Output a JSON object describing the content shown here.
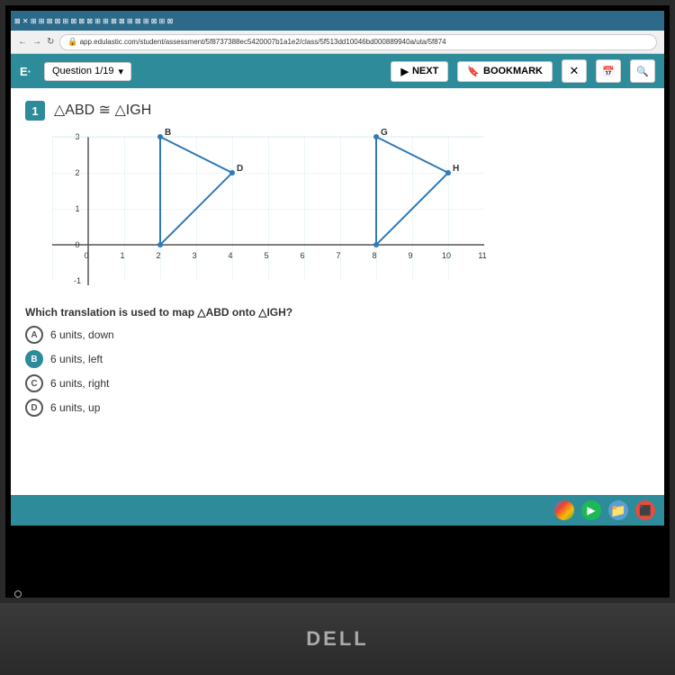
{
  "browser": {
    "tab_content": "⊠ ✕ ⊞ ⊞ ⊠ ⊠ ⊞ ⊠ ⊠ ⊠ ⊞ ⊞ ⊠ ⊠ ⊞ ⊠ ⊞ ⊠ ⊞ ⊠",
    "address": "app.edulastic.com/student/assessment/5f8737388ec5420007b1a1e2/class/5f513dd10046bd000889940a/uta/5f874",
    "nav_back": "←",
    "nav_forward": "→",
    "nav_reload": "↻"
  },
  "toolbar": {
    "question_label": "Question 1/19",
    "next_label": "NEXT",
    "bookmark_label": "BOOKMARK",
    "close_icon": "✕",
    "calendar_icon": "📅",
    "search_icon": "🔍"
  },
  "question": {
    "number": "1",
    "title": "△ABD ≅ △IGH",
    "text": "Which translation is used to map △ABD onto △IGH?",
    "choices": [
      {
        "id": "A",
        "text": "6 units, down",
        "selected": false
      },
      {
        "id": "B",
        "text": "6 units, left",
        "selected": true
      },
      {
        "id": "C",
        "text": "6 units, right",
        "selected": false
      },
      {
        "id": "D",
        "text": "6 units, up",
        "selected": false
      }
    ]
  },
  "dell": {
    "logo": "DELL"
  }
}
